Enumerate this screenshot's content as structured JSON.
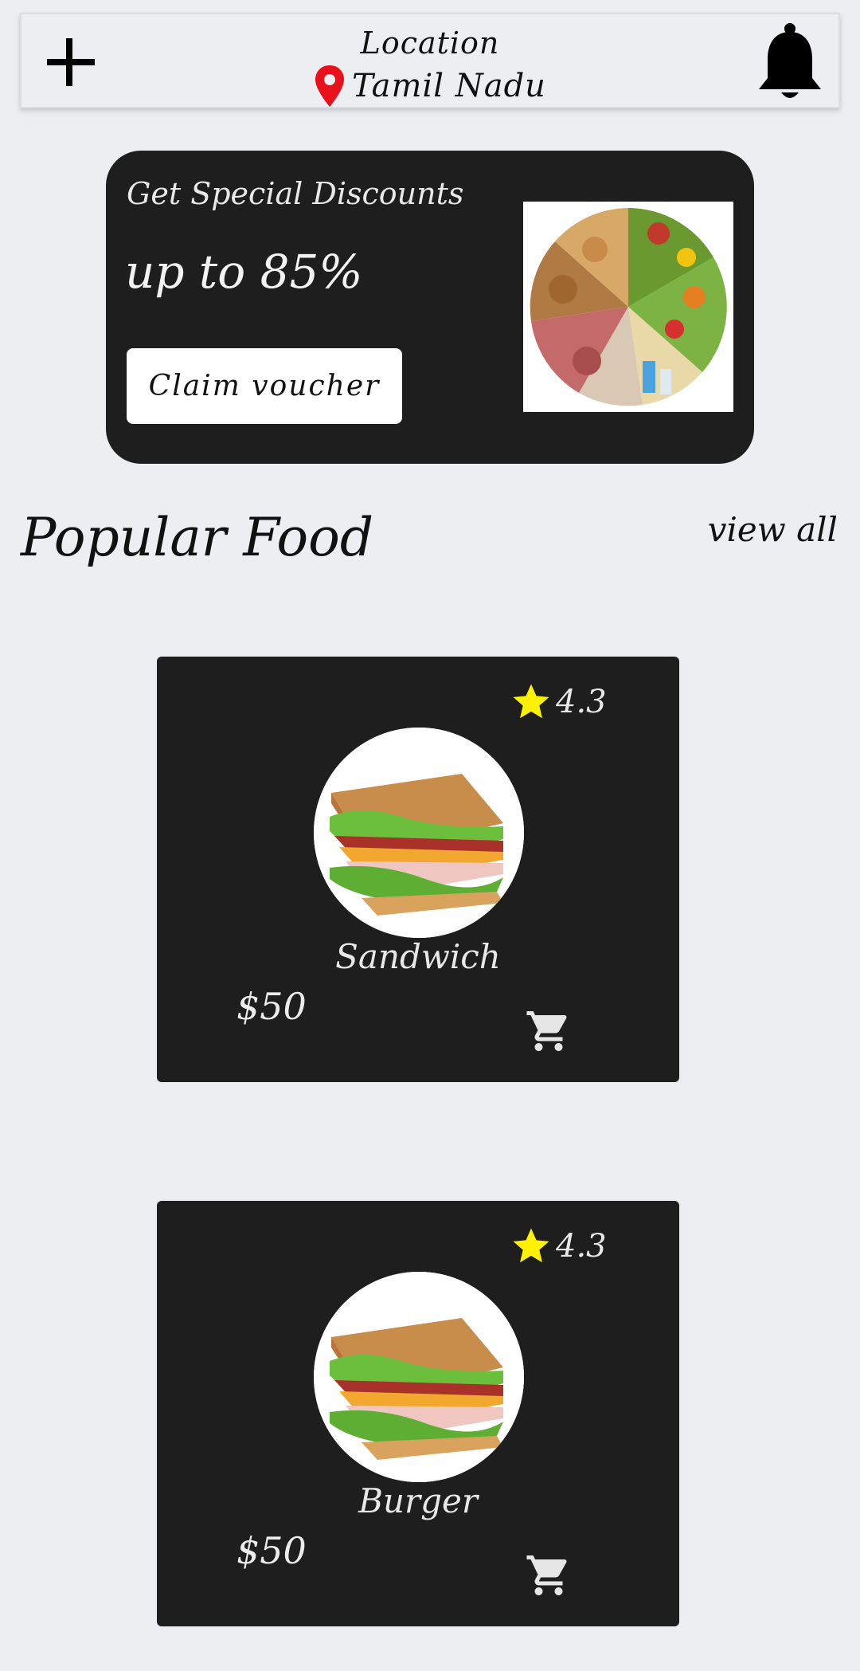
{
  "header": {
    "location_title": "Location",
    "location_value": "Tamil Nadu",
    "add_icon": "plus-icon",
    "pin_icon": "location-pin-icon",
    "notification_icon": "bell-icon"
  },
  "promo": {
    "title": "Get Special Discounts",
    "value": "up to 85%",
    "button_label": "Claim voucher"
  },
  "section": {
    "title": "Popular Food",
    "view_all_label": "view all"
  },
  "foods": [
    {
      "name": "Sandwich",
      "rating": "4.3",
      "price": "$50"
    },
    {
      "name": "Burger",
      "rating": "4.3",
      "price": "$50"
    }
  ],
  "colors": {
    "background": "#edeef1",
    "card": "#1e1e1e",
    "star": "#fff200",
    "pin": "#e8101a"
  }
}
